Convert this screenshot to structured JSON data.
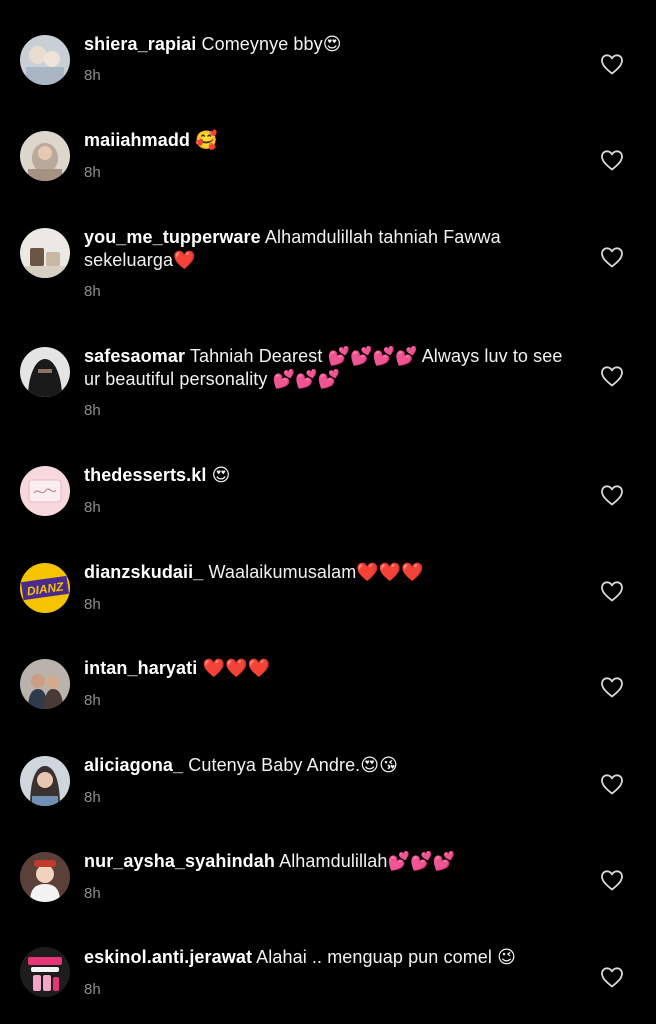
{
  "colors": {
    "background": "#000000",
    "text": "#ffffff",
    "secondary": "#8e8e8e"
  },
  "comments": [
    {
      "username": "shiera_rapiai",
      "text": "Comeynye bby😍",
      "time": "8h",
      "avatar_icon": "avatar-photo-icon",
      "like_icon": "heart-outline-icon"
    },
    {
      "username": "maiiahmadd",
      "text": "🥰",
      "time": "8h",
      "avatar_icon": "avatar-photo-icon",
      "like_icon": "heart-outline-icon"
    },
    {
      "username": "you_me_tupperware",
      "text": "Alhamdulillah tahniah Fawwa sekeluarga❤️",
      "time": "8h",
      "avatar_icon": "avatar-photo-icon",
      "like_icon": "heart-outline-icon"
    },
    {
      "username": "safesaomar",
      "text": "Tahniah Dearest 💕💕💕💕 Always luv to see ur beautiful personality 💕💕💕",
      "time": "8h",
      "avatar_icon": "avatar-photo-icon",
      "like_icon": "heart-outline-icon"
    },
    {
      "username": "thedesserts.kl",
      "text": "😍",
      "time": "8h",
      "avatar_icon": "avatar-logo-icon",
      "like_icon": "heart-outline-icon"
    },
    {
      "username": "dianzskudaii_",
      "text": "Waalaikumusalam❤️❤️❤️",
      "time": "8h",
      "avatar_icon": "avatar-logo-icon",
      "avatar_label": "DIANZ",
      "like_icon": "heart-outline-icon"
    },
    {
      "username": "intan_haryati",
      "text": "❤️❤️❤️",
      "time": "8h",
      "avatar_icon": "avatar-photo-icon",
      "like_icon": "heart-outline-icon"
    },
    {
      "username": "aliciagona_",
      "text": "Cutenya Baby Andre.😍😘",
      "time": "8h",
      "avatar_icon": "avatar-photo-icon",
      "like_icon": "heart-outline-icon"
    },
    {
      "username": "nur_aysha_syahindah",
      "text": "Alhamdulillah💕💕💕",
      "time": "8h",
      "avatar_icon": "avatar-photo-icon",
      "like_icon": "heart-outline-icon"
    },
    {
      "username": "eskinol.anti.jerawat",
      "text": "Alahai .. menguap pun comel 😉",
      "time": "8h",
      "avatar_icon": "avatar-logo-icon",
      "like_icon": "heart-outline-icon"
    }
  ]
}
